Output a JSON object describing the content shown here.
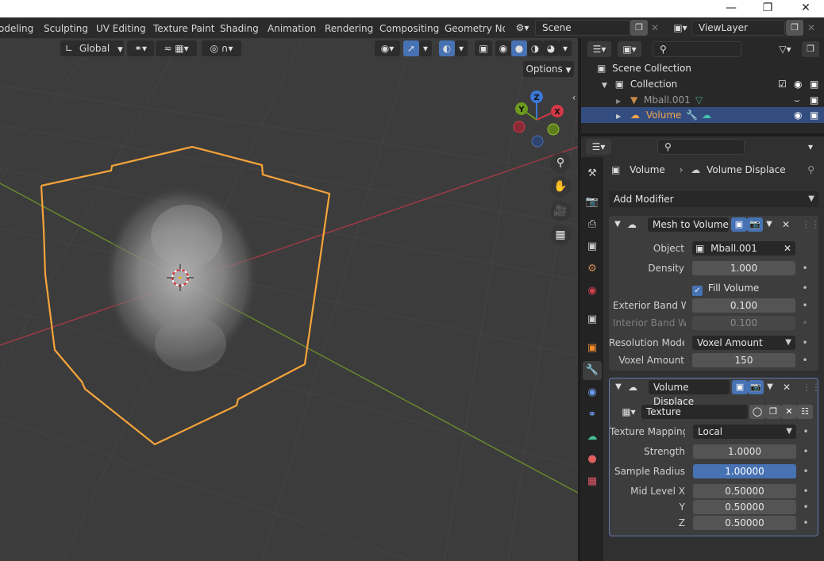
{
  "workspace_tabs": [
    "odeling",
    "Sculpting",
    "UV Editing",
    "Texture Paint",
    "Shading",
    "Animation",
    "Rendering",
    "Compositing",
    "Geometry Nod"
  ],
  "scene": {
    "value": "Scene"
  },
  "view_layer": {
    "value": "ViewLayer"
  },
  "viewport": {
    "orientation": "Global",
    "options_label": "Options",
    "gizmo": {
      "z": "Z",
      "y": "Y",
      "x": "X"
    }
  },
  "outliner": {
    "scene_collection": "Scene Collection",
    "collection": "Collection",
    "items": [
      {
        "label": "Mball.001",
        "selected": false
      },
      {
        "label": "Volume",
        "selected": true
      }
    ]
  },
  "properties": {
    "breadcrumb": {
      "object": "Volume",
      "modifier": "Volume Displace"
    },
    "add_modifier": "Add Modifier",
    "mesh_to_volume": {
      "name": "Mesh to Volume",
      "object_label": "Object",
      "object_value": "Mball.001",
      "density_label": "Density",
      "density_value": "1.000",
      "fill_volume_label": "Fill Volume",
      "exterior_label": "Exterior Band W...",
      "exterior_value": "0.100",
      "interior_label": "Interior Band Wi...",
      "interior_value": "0.100",
      "resolution_label": "Resolution Mode",
      "resolution_value": "Voxel Amount",
      "voxel_label": "Voxel Amount",
      "voxel_value": "150"
    },
    "volume_displace": {
      "name": "Volume Displace",
      "texture_value": "Texture",
      "mapping_label": "Texture Mapping",
      "mapping_value": "Local",
      "strength_label": "Strength",
      "strength_value": "1.0000",
      "radius_label": "Sample Radius",
      "radius_value": "1.00000",
      "mid_x_label": "Mid Level X",
      "mid_x_value": "0.50000",
      "mid_y_label": "Y",
      "mid_y_value": "0.50000",
      "mid_z_label": "Z",
      "mid_z_value": "0.50000"
    }
  },
  "colors": {
    "selection_outline": "#f5a43a",
    "active_blue": "#4772b3",
    "active_text": "#f4a64c"
  }
}
